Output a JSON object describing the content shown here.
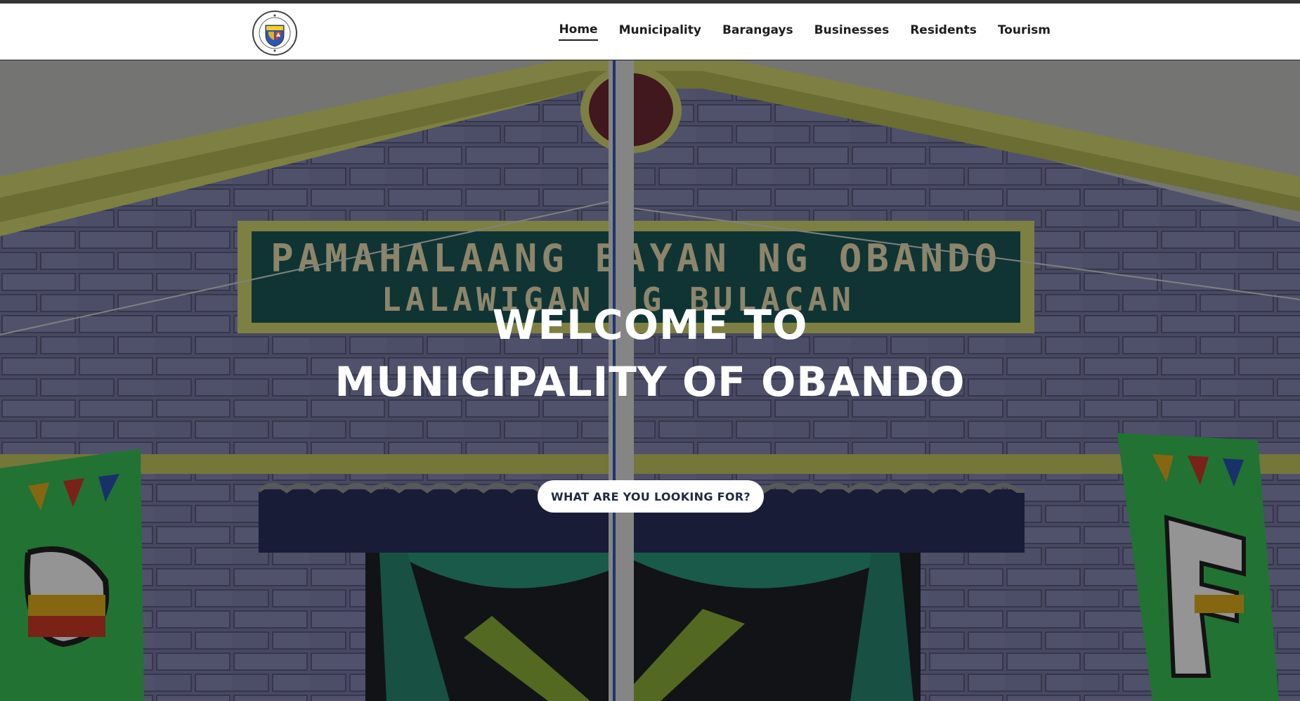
{
  "nav": {
    "logo_icon": "obando-seal-logo-icon",
    "items": [
      {
        "label": "Home",
        "active": true
      },
      {
        "label": "Municipality",
        "active": false
      },
      {
        "label": "Barangays",
        "active": false
      },
      {
        "label": "Businesses",
        "active": false
      },
      {
        "label": "Residents",
        "active": false
      },
      {
        "label": "Tourism",
        "active": false
      }
    ]
  },
  "hero": {
    "title_line1": "WELCOME TO",
    "title_line2": "MUNICIPALITY OF OBANDO",
    "cta_label": "WHAT ARE YOU LOOKING FOR?",
    "background_sign_line1": "PAMAHALAANG BAYAN NG OBANDO",
    "background_sign_line2": "LALAWIGAN NG BULACAN"
  },
  "colors": {
    "nav_bg": "#ffffff",
    "nav_text": "#1e1e1e",
    "cta_bg": "#ffffff",
    "cta_text": "#1f2a44",
    "sign_bg": "#1d5a5a",
    "sign_text": "#f2e6b8",
    "trim": "#d9dc74",
    "wall": "#7c7fa8",
    "banner": "#3cc45a"
  }
}
